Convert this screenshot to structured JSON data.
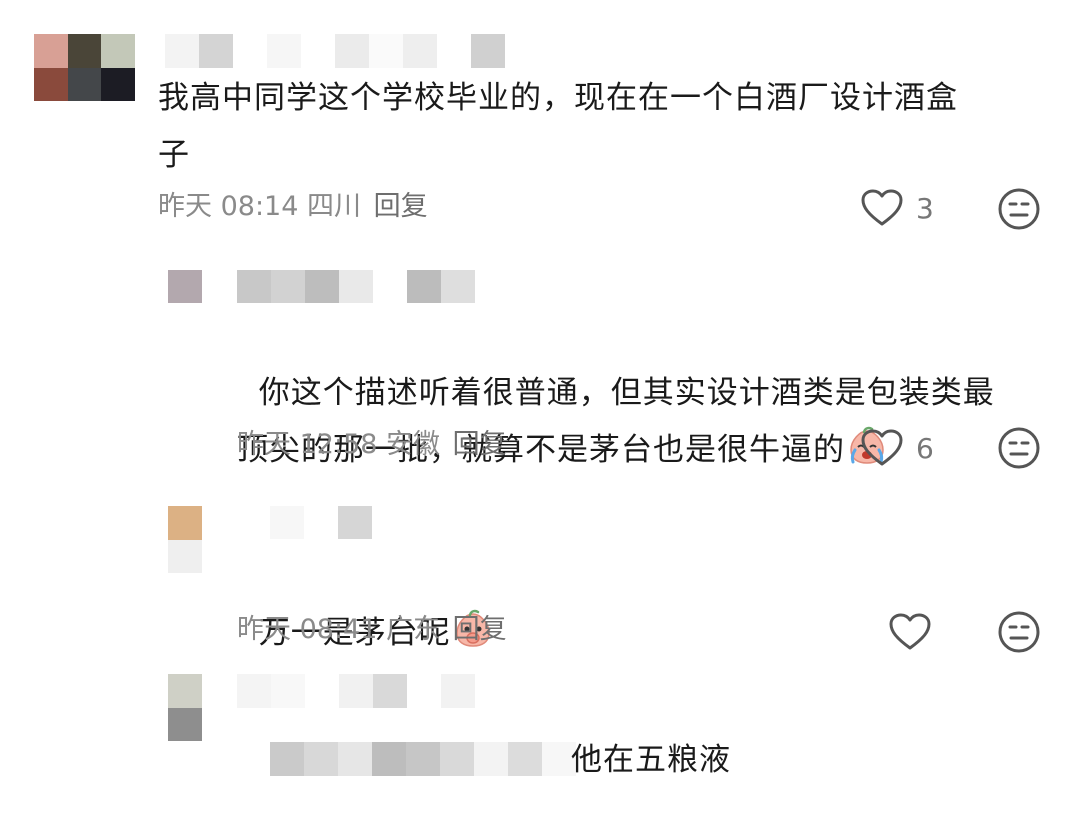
{
  "colors": {
    "text": "#1a1a1a",
    "meta": "#8a8a8a",
    "icon": "#555555"
  },
  "comments": [
    {
      "text": "我高中同学这个学校毕业的，现在在一个白酒厂设计酒盒\n子",
      "date": "昨天",
      "time": "08:14",
      "location": "四川",
      "reply_label": "回复",
      "likes": "3",
      "like_icon": "heart-outline-icon",
      "dislike_icon": "neutral-face-icon"
    },
    {
      "text": "你这个描述听着很普通，但其实设计酒类是包装类最\n顶尖的那一批，就算不是茅台也是很牛逼的",
      "emoji": "crying-peach-emoji",
      "date": "昨天",
      "time": "12:58",
      "location": "安徽",
      "reply_label": "回复",
      "likes": "6",
      "like_icon": "heart-outline-icon",
      "dislike_icon": "neutral-face-icon"
    },
    {
      "text": "万一是茅台呢",
      "emoji": "giggling-peach-emoji",
      "date": "昨天",
      "time": "08:41",
      "location": "广东",
      "reply_label": "回复",
      "likes": "",
      "like_icon": "heart-outline-icon",
      "dislike_icon": "neutral-face-icon"
    },
    {
      "text": "他在五粮液"
    }
  ]
}
